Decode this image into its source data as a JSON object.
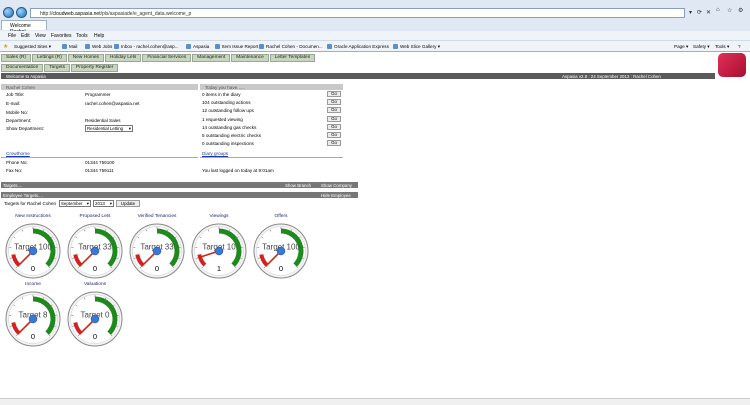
{
  "browser": {
    "url_prefix": "http://",
    "url_host": "cloudweb.aspasia.net",
    "url_path": "/pls/aspasiade/e_agent_data.welcome_p",
    "tab_title": "Welcome Rachel",
    "menu": [
      "File",
      "Edit",
      "View",
      "Favorites",
      "Tools",
      "Help"
    ],
    "favorites": [
      "Suggested Sites ▾",
      "Mail",
      "Web Jobs",
      "Inbox - rachel.cohen@asp...",
      "Aspasia",
      "Item Issue Report",
      "Rachel Cohen - Documen...",
      "Oracle Application Express",
      "Web Slice Gallery ▾"
    ],
    "toolbar_right": [
      "Page ▾",
      "Safety ▾",
      "Tools ▾",
      "?"
    ]
  },
  "app_nav": {
    "row1": [
      "Sales (R)",
      "Lettings (R)",
      "New Homes",
      "Holiday Lets",
      "Financial Services",
      "Management",
      "Maintenance",
      "Letter Templates"
    ],
    "row2": [
      "Documentation",
      "Targets",
      "Property Register"
    ]
  },
  "welcome_bar": {
    "left": "Welcome to Aspasia",
    "right": "Aspasia v2.8  :  24 September 2013  :  Rachel Cohen"
  },
  "user_panel": {
    "header": "Rachel Cohen",
    "rows": [
      {
        "label": "Job Title:",
        "value": "Programmer"
      },
      {
        "label": "E-mail:",
        "value": "rachel.cohen@aspasia.net"
      },
      {
        "label": "Mobile No:",
        "value": ""
      },
      {
        "label": "Department:",
        "value": "Residential Sales"
      }
    ],
    "show_department_label": "Show Department:",
    "show_department_value": "Residential Letting"
  },
  "today_panel": {
    "header": "Today you have......",
    "items": [
      "0 items in the diary",
      "104 outstanding actions",
      "12 outstanding follow ups",
      "1 requested viewing",
      "14 outstanding gas checks",
      "5 outstanding electric checks",
      "0 outstanding inspections"
    ],
    "go_label": "Go"
  },
  "office": {
    "name": "Crowthorne",
    "phone_label": "Phone No:",
    "phone": "01344 759100",
    "fax_label": "Fax No:",
    "fax": "01344 759111"
  },
  "diary": {
    "link": "Diary groups",
    "last_login": "You last logged on today at 9:01am"
  },
  "targets_bar": {
    "left": "Targets....",
    "show_branch": "Show Branch",
    "show_company": "Show Company"
  },
  "employee_targets_bar": {
    "left": "Employee Targets....",
    "hide": "Hide Employee"
  },
  "targets_form": {
    "label": "Targets for Rachel Cohen",
    "month": "September",
    "year": "2013",
    "update": "Update"
  },
  "gauges": [
    {
      "title": "New Instructions",
      "target_label": "Target 100",
      "value": 0,
      "target": 100
    },
    {
      "title": "Proposed Lets",
      "target_label": "Target 33",
      "value": 0,
      "target": 33
    },
    {
      "title": "Verified Tenancies",
      "target_label": "Target 33",
      "value": 0,
      "target": 33
    },
    {
      "title": "Viewings",
      "target_label": "Target 10",
      "value": 1,
      "target": 10
    },
    {
      "title": "Offers",
      "target_label": "Target 100",
      "value": 0,
      "target": 100
    },
    {
      "title": "Income",
      "target_label": "Target 8",
      "value": 0,
      "target": 8
    },
    {
      "title": "Valuations",
      "target_label": "Target 0",
      "value": 0,
      "target": 0
    }
  ],
  "colors": {
    "green_band": "#1e8a1e",
    "red_band": "#d42020",
    "needle": "#c62a1a",
    "hub": "#3a78d8"
  }
}
